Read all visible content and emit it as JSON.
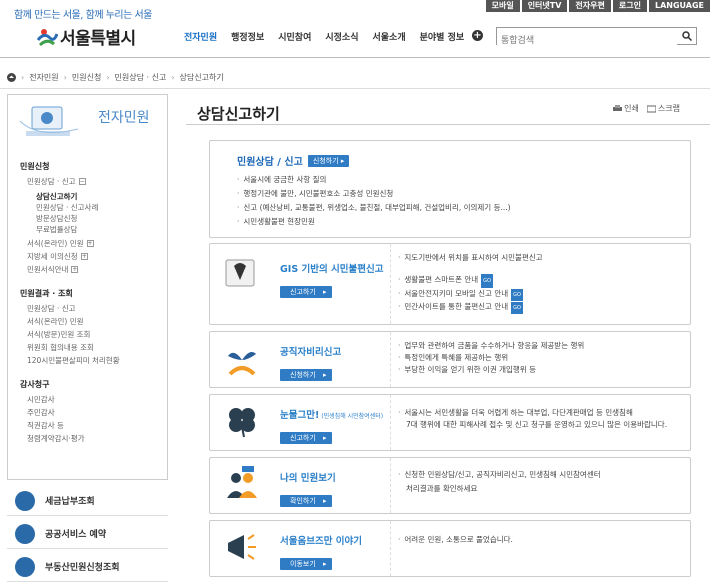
{
  "top_links": [
    "모바일",
    "인터넷TV",
    "전자우편",
    "로그인",
    "LANGUAGE"
  ],
  "slogan": "함께 만드는 서울, 함께 누리는 서울",
  "logo_name": "서울특별시",
  "gnb": [
    "전자민원",
    "행정정보",
    "시민참여",
    "시정소식",
    "서울소개",
    "분야별 정보"
  ],
  "search_placeholder": "통합검색",
  "breadcrumb": [
    "전자민원",
    "민원신청",
    "민원상담 · 신고",
    "상담신고하기"
  ],
  "lnb": {
    "title": "전자민원",
    "sections": [
      {
        "title": "민원신청",
        "items": [
          {
            "label": "민원상담 · 신고",
            "box": "−",
            "subs": [
              {
                "label": "상담신고하기",
                "on": true
              },
              {
                "label": "민원상담 · 신고사례",
                "on": false
              },
              {
                "label": "방문상담신청",
                "on": false
              },
              {
                "label": "무료법률상담",
                "on": false
              }
            ]
          },
          {
            "label": "서식(온라인) 민원",
            "box": "+"
          },
          {
            "label": "지방세 이의신청",
            "box": "+"
          },
          {
            "label": "민원서식안내",
            "box": "+"
          }
        ]
      },
      {
        "title": "민원결과 · 조회",
        "items": [
          {
            "label": "민원상담 · 신고"
          },
          {
            "label": "서식(온라인) 민원"
          },
          {
            "label": "서식(방문)민원 조회"
          },
          {
            "label": "위원회 협의내용 조회"
          },
          {
            "label": "120시민불편살피미 처리현황"
          }
        ]
      },
      {
        "title": "감사청구",
        "items": [
          {
            "label": "시민감사"
          },
          {
            "label": "주민감사"
          },
          {
            "label": "직권감사 등"
          },
          {
            "label": "청렴계약감시·평가"
          }
        ]
      }
    ]
  },
  "quick": [
    "세금납부조회",
    "공공서비스 예약",
    "부동산민원신청조회"
  ],
  "page_title": "상담신고하기",
  "tools": {
    "print": "인쇄",
    "scrap": "스크랩"
  },
  "card1": {
    "title": "민원상담 / 신고",
    "btn": "신청하기",
    "bullets": [
      "서울시에 궁금한 사항 질의",
      "행정기관에 불만, 시민불편호소 고충성 민원신청",
      "신고 (예산낭비, 교통불편, 위생업소, 불친절, 대부업피해, 건설업비리, 이의제기 등...)",
      "시민생활불편 현장민원"
    ]
  },
  "card2": {
    "title": "GIS 기반의 시민불편신고",
    "btn": "신고하기",
    "bullets": [
      "지도기반에서 위치를 표시하여 시민불편신고"
    ],
    "links": [
      "생활불편 스마트폰 안내",
      "서울안전지키미 모바일 신고 안내",
      "민간사이트를 통한 불편신고 안내"
    ],
    "go": "GO"
  },
  "card3": {
    "title": "공직자비리신고",
    "btn": "신청하기",
    "bullets": [
      "업무와 관련하여 금품을 수수하거나 향응을 제공받는 행위",
      "특정인에게 특혜를 제공하는 행위",
      "부당한 이익을 얻기 위한 이권 개입행위 등"
    ]
  },
  "card4": {
    "title": "눈물그만!",
    "title_small": "(민생침해 시민참여센터)",
    "btn": "신고하기",
    "bullets": [
      "서울시는 서민생활을 더욱 어렵게 하는 대부업, 다단계판매업 등 민생침해"
    ],
    "cont": "7대 행위에 대한 피해사례 접수 및 신고 청구를 운영하고 있으니 많은 이용바랍니다."
  },
  "card5": {
    "title": "나의 민원보기",
    "btn": "확인하기",
    "bullets": [
      "신청한 민원상담/신고, 공직자비리신고, 민생침해 시민참여센터"
    ],
    "cont": "처리결과를 확인하세요"
  },
  "card6": {
    "title": "서울옴브즈만 이야기",
    "btn": "이동보기",
    "bullets": [
      "어려운 민원, 소통으로 풀었습니다."
    ]
  },
  "colors": {
    "accent": "#2f7bc4",
    "brand_blue": "#1a6fc4"
  }
}
